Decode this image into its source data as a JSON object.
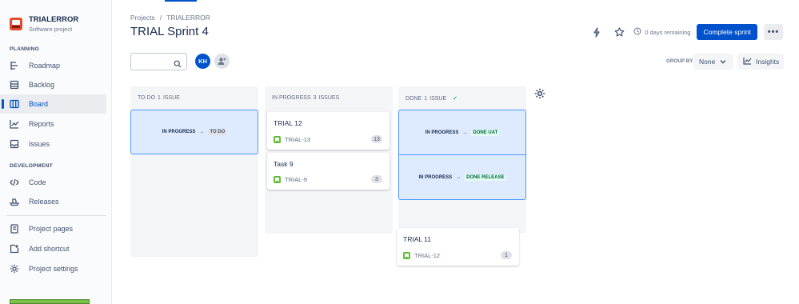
{
  "sidebar": {
    "project_name": "TRIALERROR",
    "project_type": "Software project",
    "planning_label": "PLANNING",
    "planning_items": [
      {
        "label": "Roadmap",
        "icon": "roadmap-icon"
      },
      {
        "label": "Backlog",
        "icon": "backlog-icon"
      },
      {
        "label": "Board",
        "icon": "board-icon",
        "active": true
      },
      {
        "label": "Reports",
        "icon": "reports-icon"
      },
      {
        "label": "Issues",
        "icon": "issues-icon"
      }
    ],
    "development_label": "DEVELOPMENT",
    "development_items": [
      {
        "label": "Code",
        "icon": "code-icon"
      },
      {
        "label": "Releases",
        "icon": "releases-icon"
      }
    ],
    "footer_items": [
      {
        "label": "Project pages",
        "icon": "pages-icon"
      },
      {
        "label": "Add shortcut",
        "icon": "add-shortcut-icon"
      },
      {
        "label": "Project settings",
        "icon": "settings-icon"
      }
    ]
  },
  "header": {
    "breadcrumb": [
      "Projects",
      "TRIALERROR"
    ],
    "breadcrumb_sep": "/",
    "title": "TRIAL Sprint 4",
    "days_remaining": "0 days remaining",
    "complete_button": "Complete sprint",
    "more_button": "•••"
  },
  "toolbar": {
    "avatar_initials": "KH",
    "group_by_label": "GROUP BY",
    "group_by_value": "None",
    "insights_label": "Insights"
  },
  "columns": [
    {
      "name": "TO DO",
      "count": "1",
      "count_label": "ISSUE",
      "drops": [
        {
          "from": "IN PROGRESS",
          "arrow": "→",
          "to": "TO DO"
        }
      ]
    },
    {
      "name": "IN PROGRESS",
      "count": "3",
      "count_label": "ISSUES",
      "cards": [
        {
          "title": "TRIAL 12",
          "key": "TRIAL-13",
          "estimate": "13"
        },
        {
          "title": "Task 9",
          "key": "TRIAL-9",
          "estimate": "3"
        }
      ]
    },
    {
      "name": "DONE",
      "count": "1",
      "count_label": "ISSUE",
      "done_check": "✓",
      "drops": [
        {
          "from": "IN PROGRESS",
          "arrow": "→",
          "to": "DONE UAT"
        },
        {
          "from": "IN PROGRESS",
          "arrow": "→",
          "to": "DONE RELEASE"
        }
      ],
      "dragged_card": {
        "title": "TRIAL 11",
        "key": "TRIAL-12",
        "estimate": "1"
      }
    }
  ],
  "colors": {
    "primary": "#0052cc",
    "drop_bg": "#deebff",
    "drop_border": "#4c9aff",
    "story_green": "#63ba3c",
    "done_green": "#006644"
  }
}
